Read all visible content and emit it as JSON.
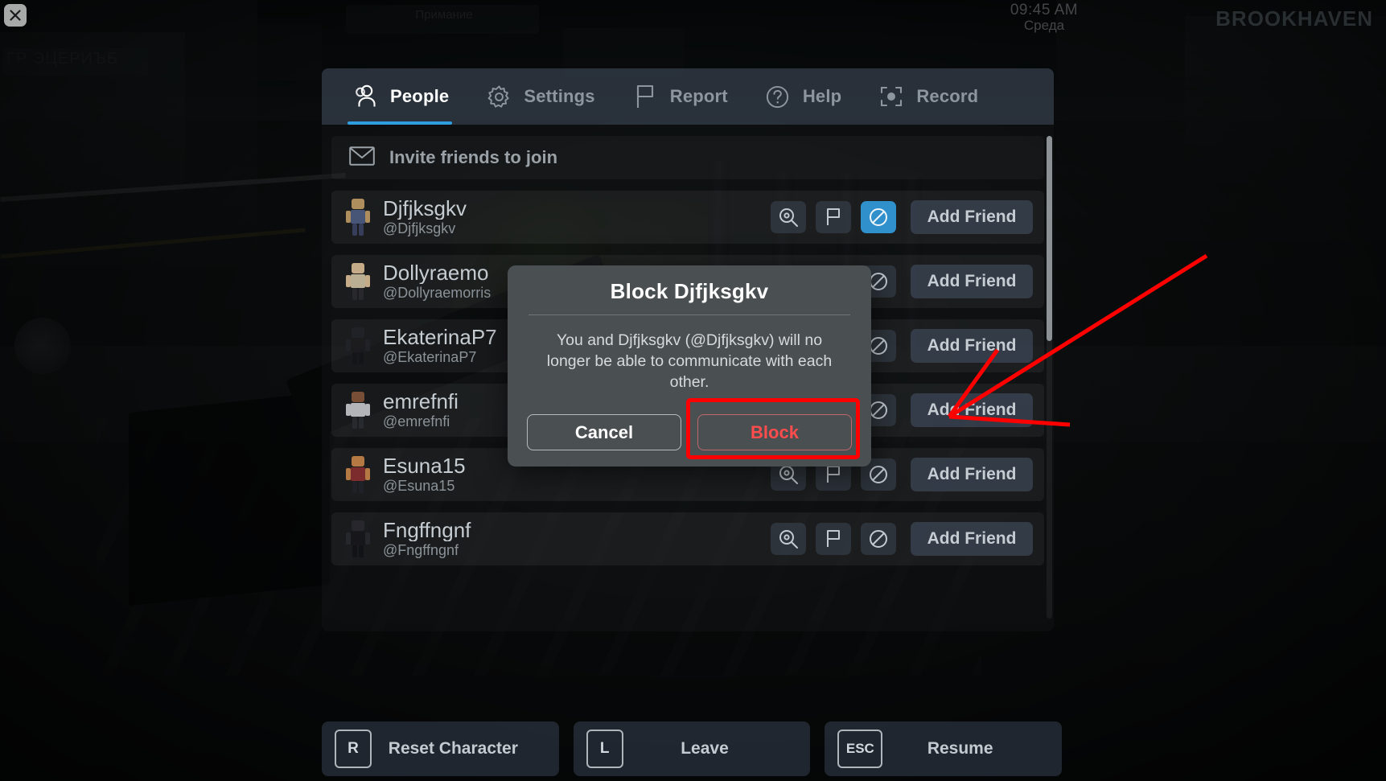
{
  "hud": {
    "close_icon": "close-icon",
    "clock_time": "09:45 AM",
    "clock_day": "Среда",
    "brand": "BROOKHAVEN",
    "bg_sign_left": "ГР ЭЦЕРИЪБ",
    "bg_shop_sign": "Примание"
  },
  "tabs": [
    {
      "id": "people",
      "label": "People",
      "icon": "people-icon",
      "active": true
    },
    {
      "id": "settings",
      "label": "Settings",
      "icon": "gear-icon",
      "active": false
    },
    {
      "id": "report",
      "label": "Report",
      "icon": "flag-icon",
      "active": false
    },
    {
      "id": "help",
      "label": "Help",
      "icon": "question-icon",
      "active": false
    },
    {
      "id": "record",
      "label": "Record",
      "icon": "record-icon",
      "active": false
    }
  ],
  "invite": {
    "label": "Invite friends to join",
    "icon": "envelope-icon"
  },
  "actions": {
    "inspect_icon": "magnifier-icon",
    "report_icon": "flag-icon",
    "block_icon": "block-icon",
    "add_friend_label": "Add Friend"
  },
  "players": [
    {
      "display": "Djfjksgkv",
      "handle": "@Djfjksgkv",
      "block_active": true,
      "skin": "#4f5f86",
      "head": "#c9a26a",
      "legs": "#3b4566"
    },
    {
      "display": "Dollyraemo",
      "handle": "@Dollyraemorris",
      "block_active": false,
      "skin": "#d8c9a8",
      "head": "#e3c59a",
      "legs": "#2b2b2f"
    },
    {
      "display": "EkaterinaP7",
      "handle": "@EkaterinaP7",
      "block_active": false,
      "skin": "#1d1d20",
      "head": "#23232a",
      "legs": "#15151a"
    },
    {
      "display": "emrefnfi",
      "handle": "@emrefnfi",
      "block_active": false,
      "skin": "#cfd2d6",
      "head": "#8a5a3c",
      "legs": "#2a2d33"
    },
    {
      "display": "Esuna15",
      "handle": "@Esuna15",
      "block_active": false,
      "skin": "#8d2f2f",
      "head": "#d08a4a",
      "legs": "#20222a"
    },
    {
      "display": "Fngffngnf",
      "handle": "@Fngffngnf",
      "block_active": false,
      "skin": "#17171b",
      "head": "#2a2a30",
      "legs": "#121216"
    }
  ],
  "bottom_bar": [
    {
      "key": "R",
      "label": "Reset Character"
    },
    {
      "key": "L",
      "label": "Leave"
    },
    {
      "key": "ESC",
      "label": "Resume"
    }
  ],
  "modal": {
    "title": "Block Djfjksgkv",
    "body": "You and Djfjksgkv (@Djfjksgkv) will no longer be able to communicate with each other.",
    "cancel_label": "Cancel",
    "confirm_label": "Block"
  },
  "annotation": {
    "color": "#ff0000",
    "highlight_target": "Block"
  }
}
